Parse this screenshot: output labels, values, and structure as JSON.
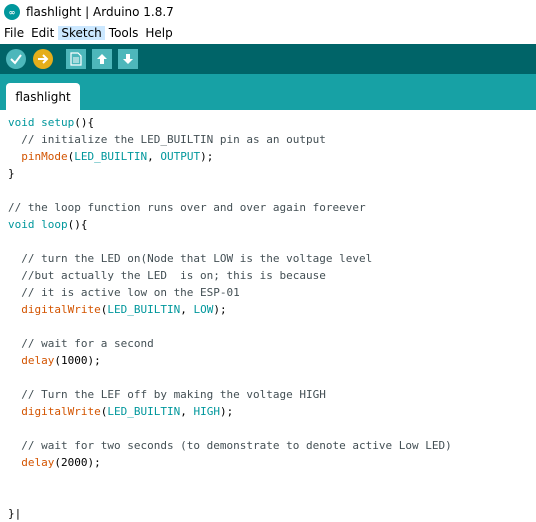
{
  "window": {
    "title": "flashlight | Arduino 1.8.7",
    "icon_letters": "∞"
  },
  "menu": [
    "File",
    "Edit",
    "Sketch",
    "Tools",
    "Help"
  ],
  "toolbar": {
    "buttons": [
      {
        "name": "verify-icon"
      },
      {
        "name": "upload-icon"
      },
      {
        "name": "new-icon"
      },
      {
        "name": "open-icon"
      },
      {
        "name": "save-icon"
      }
    ],
    "accent": "#006468"
  },
  "tabs": [
    {
      "label": "flashlight"
    }
  ],
  "code_lines": [
    [
      {
        "t": "void",
        "c": "kw"
      },
      {
        "t": " ",
        "c": "pl"
      },
      {
        "t": "setup",
        "c": "kw"
      },
      {
        "t": "(){",
        "c": "pl"
      }
    ],
    [
      {
        "t": "  // initialize the LED_BUILTIN pin as an output",
        "c": "cm"
      }
    ],
    [
      {
        "t": "  ",
        "c": "pl"
      },
      {
        "t": "pinMode",
        "c": "fn"
      },
      {
        "t": "(",
        "c": "pl"
      },
      {
        "t": "LED_BUILTIN",
        "c": "kw"
      },
      {
        "t": ", ",
        "c": "pl"
      },
      {
        "t": "OUTPUT",
        "c": "kw"
      },
      {
        "t": ");",
        "c": "pl"
      }
    ],
    [
      {
        "t": "}",
        "c": "pl"
      }
    ],
    [
      {
        "t": "",
        "c": "pl"
      }
    ],
    [
      {
        "t": "// the loop function runs over and over again foreever",
        "c": "cm"
      }
    ],
    [
      {
        "t": "void",
        "c": "kw"
      },
      {
        "t": " ",
        "c": "pl"
      },
      {
        "t": "loop",
        "c": "kw"
      },
      {
        "t": "(){",
        "c": "pl"
      }
    ],
    [
      {
        "t": "",
        "c": "pl"
      }
    ],
    [
      {
        "t": "  // turn the LED on(Node that LOW is the voltage level",
        "c": "cm"
      }
    ],
    [
      {
        "t": "  //but actually the LED  is on; this is because",
        "c": "cm"
      }
    ],
    [
      {
        "t": "  // it is active low on the ESP-01",
        "c": "cm"
      }
    ],
    [
      {
        "t": "  ",
        "c": "pl"
      },
      {
        "t": "digitalWrite",
        "c": "fn"
      },
      {
        "t": "(",
        "c": "pl"
      },
      {
        "t": "LED_BUILTIN",
        "c": "kw"
      },
      {
        "t": ", ",
        "c": "pl"
      },
      {
        "t": "LOW",
        "c": "kw"
      },
      {
        "t": ");",
        "c": "pl"
      }
    ],
    [
      {
        "t": "",
        "c": "pl"
      }
    ],
    [
      {
        "t": "  // wait for a second",
        "c": "cm"
      }
    ],
    [
      {
        "t": "  ",
        "c": "pl"
      },
      {
        "t": "delay",
        "c": "fn"
      },
      {
        "t": "(1000);",
        "c": "pl"
      }
    ],
    [
      {
        "t": "",
        "c": "pl"
      }
    ],
    [
      {
        "t": "  // Turn the LEF off by making the voltage HIGH",
        "c": "cm"
      }
    ],
    [
      {
        "t": "  ",
        "c": "pl"
      },
      {
        "t": "digitalWrite",
        "c": "fn"
      },
      {
        "t": "(",
        "c": "pl"
      },
      {
        "t": "LED_BUILTIN",
        "c": "kw"
      },
      {
        "t": ", ",
        "c": "pl"
      },
      {
        "t": "HIGH",
        "c": "kw"
      },
      {
        "t": ");",
        "c": "pl"
      }
    ],
    [
      {
        "t": "",
        "c": "pl"
      }
    ],
    [
      {
        "t": "  // wait for two seconds (to demonstrate to denote active Low LED)",
        "c": "cm"
      }
    ],
    [
      {
        "t": "  ",
        "c": "pl"
      },
      {
        "t": "delay",
        "c": "fn"
      },
      {
        "t": "(2000);",
        "c": "pl"
      }
    ],
    [
      {
        "t": "",
        "c": "pl"
      }
    ],
    [
      {
        "t": "",
        "c": "pl"
      }
    ],
    [
      {
        "t": "}",
        "c": "pl"
      }
    ]
  ]
}
